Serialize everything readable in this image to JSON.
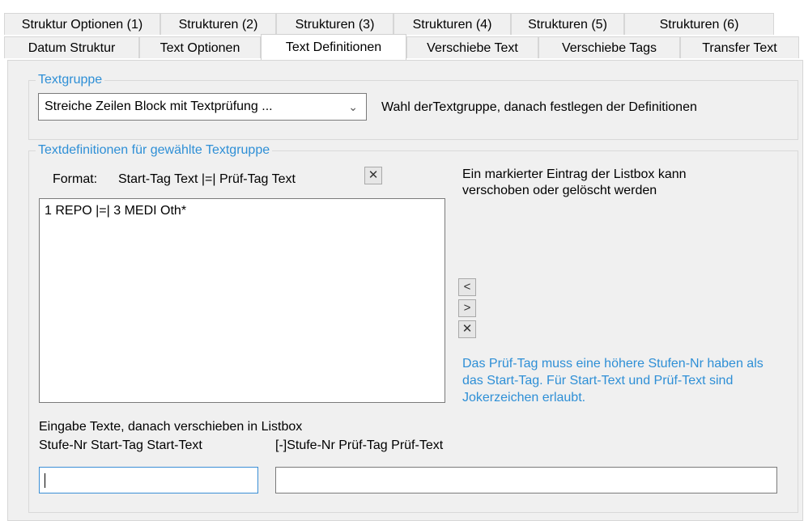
{
  "tabs": {
    "row1": [
      {
        "label": "Struktur Optionen (1)"
      },
      {
        "label": "Strukturen (2)"
      },
      {
        "label": "Strukturen (3)"
      },
      {
        "label": "Strukturen (4)"
      },
      {
        "label": "Strukturen (5)"
      },
      {
        "label": "Strukturen (6)"
      }
    ],
    "row2": [
      {
        "label": "Datum Struktur"
      },
      {
        "label": "Text Optionen"
      },
      {
        "label": "Text Definitionen",
        "selected": true
      },
      {
        "label": "Verschiebe Text"
      },
      {
        "label": "Verschiebe Tags"
      },
      {
        "label": "Transfer Text"
      }
    ]
  },
  "textgruppe": {
    "title": "Textgruppe",
    "selected_value": "Streiche Zeilen Block mit Textprüfung ...",
    "hint": "Wahl derTextgruppe, danach festlegen der Definitionen"
  },
  "definitions": {
    "title": "Textdefinitionen für gewählte Textgruppe",
    "format_label": "Format:",
    "format_value": "Start-Tag Text |=| Prüf-Tag Text",
    "format_clear_glyph": "✕",
    "list_info": "Ein markierter Eintrag der Listbox kann verschoben oder gelöscht werden",
    "list_items": [
      "1 REPO |=| 3 MEDI Oth*"
    ],
    "move_left_glyph": "<",
    "move_right_glyph": ">",
    "delete_glyph": "✕",
    "help_text": "Das Prüf-Tag muss eine höhere Stufen-Nr haben als das Start-Tag. Für Start-Text und Prüf-Text sind Jokerzeichen erlaubt.",
    "input_caption": "Eingabe Texte, danach verschieben in Listbox",
    "start_label": "Stufe-Nr Start-Tag Start-Text",
    "pruef_label": "[-]Stufe-Nr Prüf-Tag Prüf-Text",
    "start_value": "",
    "pruef_value": ""
  },
  "colors": {
    "group_title": "#2e8fd6",
    "panel_bg": "#f0f0f0",
    "focus_border": "#3b8fd6"
  }
}
